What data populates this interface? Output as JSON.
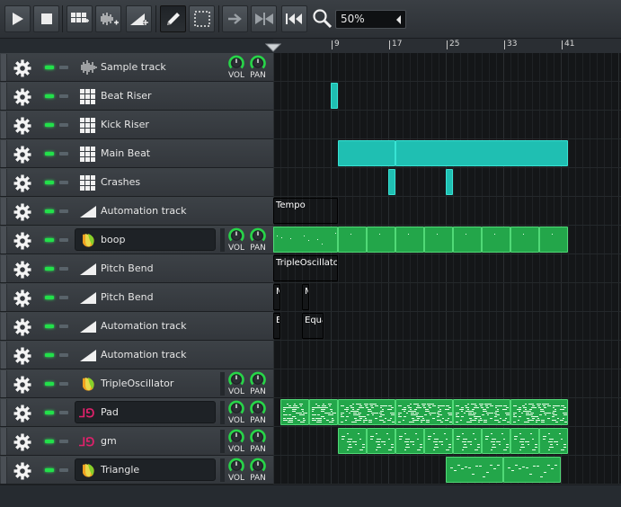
{
  "toolbar": {
    "buttons": [
      {
        "name": "play-button",
        "icon": "play-icon"
      },
      {
        "name": "stop-button",
        "icon": "stop-icon"
      },
      {
        "name": "add-beat-button",
        "icon": "beat-grid-icon"
      },
      {
        "name": "add-sample-track-button",
        "icon": "waveform-icon"
      },
      {
        "name": "add-automation-track-button",
        "icon": "automation-add-icon"
      },
      {
        "name": "draw-mode-button",
        "icon": "pencil-icon",
        "active": true
      },
      {
        "name": "edit-mode-button",
        "icon": "select-rect-icon"
      },
      {
        "name": "auto-scroll-button",
        "icon": "arrow-right-icon"
      },
      {
        "name": "loop-points-button",
        "icon": "loop-icon"
      },
      {
        "name": "stop-behaviour-button",
        "icon": "skip-back-icon"
      }
    ],
    "zoom": {
      "value": "50%",
      "icon": "magnifier-icon"
    }
  },
  "timeline": {
    "bars": [
      {
        "label": "9",
        "bar": 9
      },
      {
        "label": "17",
        "bar": 17
      },
      {
        "label": "25",
        "bar": 25
      },
      {
        "label": "33",
        "bar": 33
      },
      {
        "label": "41",
        "bar": 41
      }
    ]
  },
  "knobs": {
    "vol": "VOL",
    "pan": "PAN"
  },
  "tracks": [
    {
      "label": "Sample track",
      "icon": "waveform-icon",
      "kind": "sample",
      "knobs": true
    },
    {
      "label": "Beat Riser",
      "icon": "beat-grid-icon",
      "kind": "beat"
    },
    {
      "label": "Kick Riser",
      "icon": "beat-grid-icon",
      "kind": "beat"
    },
    {
      "label": "Main Beat",
      "icon": "beat-grid-icon",
      "kind": "beat"
    },
    {
      "label": "Crashes",
      "icon": "beat-grid-icon",
      "kind": "beat"
    },
    {
      "label": "Automation track",
      "icon": "automation-ramp-icon",
      "kind": "automation"
    },
    {
      "label": "boop",
      "icon": "tripleoscillator-icon",
      "kind": "instrument",
      "boxed": true,
      "knobs": true
    },
    {
      "label": "Pitch Bend",
      "icon": "automation-ramp-icon",
      "kind": "automation"
    },
    {
      "label": "Pitch Bend",
      "icon": "automation-ramp-icon",
      "kind": "automation"
    },
    {
      "label": "Automation track",
      "icon": "automation-ramp-icon",
      "kind": "automation"
    },
    {
      "label": "Automation track",
      "icon": "automation-ramp-icon",
      "kind": "automation"
    },
    {
      "label": "TripleOscillator",
      "icon": "tripleoscillator-icon",
      "kind": "instrument",
      "boxed": false,
      "knobs": true
    },
    {
      "label": "Pad",
      "icon": "sf2-icon",
      "kind": "instrument",
      "boxed": true,
      "knobs": true
    },
    {
      "label": "gm",
      "icon": "sf2-icon",
      "kind": "instrument",
      "boxed": false,
      "knobs": true
    },
    {
      "label": "Triangle",
      "icon": "tripleoscillator-icon",
      "kind": "instrument",
      "boxed": true,
      "knobs": true
    }
  ],
  "clips": [
    {
      "track": 1,
      "type": "beat",
      "start": 9,
      "length": 1,
      "label": ""
    },
    {
      "track": 3,
      "type": "beat",
      "start": 10,
      "length": 8,
      "label": ""
    },
    {
      "track": 3,
      "type": "beat",
      "start": 18,
      "length": 24,
      "label": ""
    },
    {
      "track": 4,
      "type": "beat",
      "start": 17,
      "length": 1,
      "label": ""
    },
    {
      "track": 4,
      "type": "beat",
      "start": 25,
      "length": 1,
      "label": ""
    },
    {
      "track": 5,
      "type": "automation",
      "start": 1,
      "length": 9,
      "label": "Tempo"
    },
    {
      "track": 6,
      "type": "pattern",
      "start": 1,
      "length": 9,
      "label": "",
      "notes": "sparse"
    },
    {
      "track": 6,
      "type": "pattern",
      "start": 10,
      "length": 4,
      "label": "",
      "notes": "sparse"
    },
    {
      "track": 6,
      "type": "pattern",
      "start": 14,
      "length": 4,
      "label": "",
      "notes": "sparse"
    },
    {
      "track": 6,
      "type": "pattern",
      "start": 18,
      "length": 4,
      "label": "",
      "notes": "sparse"
    },
    {
      "track": 6,
      "type": "pattern",
      "start": 22,
      "length": 4,
      "label": "",
      "notes": "sparse"
    },
    {
      "track": 6,
      "type": "pattern",
      "start": 26,
      "length": 4,
      "label": "",
      "notes": "sparse"
    },
    {
      "track": 6,
      "type": "pattern",
      "start": 30,
      "length": 4,
      "label": "",
      "notes": "sparse"
    },
    {
      "track": 6,
      "type": "pattern",
      "start": 34,
      "length": 4,
      "label": "",
      "notes": "sparse"
    },
    {
      "track": 6,
      "type": "pattern",
      "start": 38,
      "length": 4,
      "label": "",
      "notes": "sparse"
    },
    {
      "track": 7,
      "type": "automation",
      "start": 1,
      "length": 9,
      "label": "TripleOscillator"
    },
    {
      "track": 8,
      "type": "automation",
      "start": 1,
      "length": 1,
      "label": "M"
    },
    {
      "track": 8,
      "type": "automation",
      "start": 5,
      "length": 1,
      "label": "M"
    },
    {
      "track": 9,
      "type": "automation",
      "start": 1,
      "length": 1,
      "label": "E"
    },
    {
      "track": 9,
      "type": "automation",
      "start": 5,
      "length": 3,
      "label": "Equa"
    },
    {
      "track": 12,
      "type": "pattern",
      "start": 2,
      "length": 4,
      "label": "",
      "notes": "dense"
    },
    {
      "track": 12,
      "type": "pattern",
      "start": 6,
      "length": 4,
      "label": "",
      "notes": "dense"
    },
    {
      "track": 12,
      "type": "pattern",
      "start": 10,
      "length": 8,
      "label": "",
      "notes": "dense"
    },
    {
      "track": 12,
      "type": "pattern",
      "start": 18,
      "length": 8,
      "label": "",
      "notes": "dense"
    },
    {
      "track": 12,
      "type": "pattern",
      "start": 26,
      "length": 8,
      "label": "",
      "notes": "dense"
    },
    {
      "track": 12,
      "type": "pattern",
      "start": 34,
      "length": 8,
      "label": "",
      "notes": "dense"
    },
    {
      "track": 13,
      "type": "pattern",
      "start": 10,
      "length": 4,
      "label": "",
      "notes": "mid"
    },
    {
      "track": 13,
      "type": "pattern",
      "start": 14,
      "length": 4,
      "label": "",
      "notes": "mid"
    },
    {
      "track": 13,
      "type": "pattern",
      "start": 18,
      "length": 4,
      "label": "",
      "notes": "mid"
    },
    {
      "track": 13,
      "type": "pattern",
      "start": 22,
      "length": 4,
      "label": "",
      "notes": "mid"
    },
    {
      "track": 13,
      "type": "pattern",
      "start": 26,
      "length": 4,
      "label": "",
      "notes": "mid"
    },
    {
      "track": 13,
      "type": "pattern",
      "start": 30,
      "length": 4,
      "label": "",
      "notes": "mid"
    },
    {
      "track": 13,
      "type": "pattern",
      "start": 34,
      "length": 4,
      "label": "",
      "notes": "mid"
    },
    {
      "track": 13,
      "type": "pattern",
      "start": 38,
      "length": 4,
      "label": "",
      "notes": "mid"
    },
    {
      "track": 14,
      "type": "pattern",
      "start": 25,
      "length": 8,
      "label": "",
      "notes": "melody"
    },
    {
      "track": 14,
      "type": "pattern",
      "start": 33,
      "length": 8,
      "label": "",
      "notes": "melody"
    }
  ],
  "colors": {
    "beat": "#1fbfb2",
    "automation": "#6e3be6",
    "pattern": "#23a64a",
    "led_on": "#22e04a",
    "knob_arc": "#27d548"
  }
}
